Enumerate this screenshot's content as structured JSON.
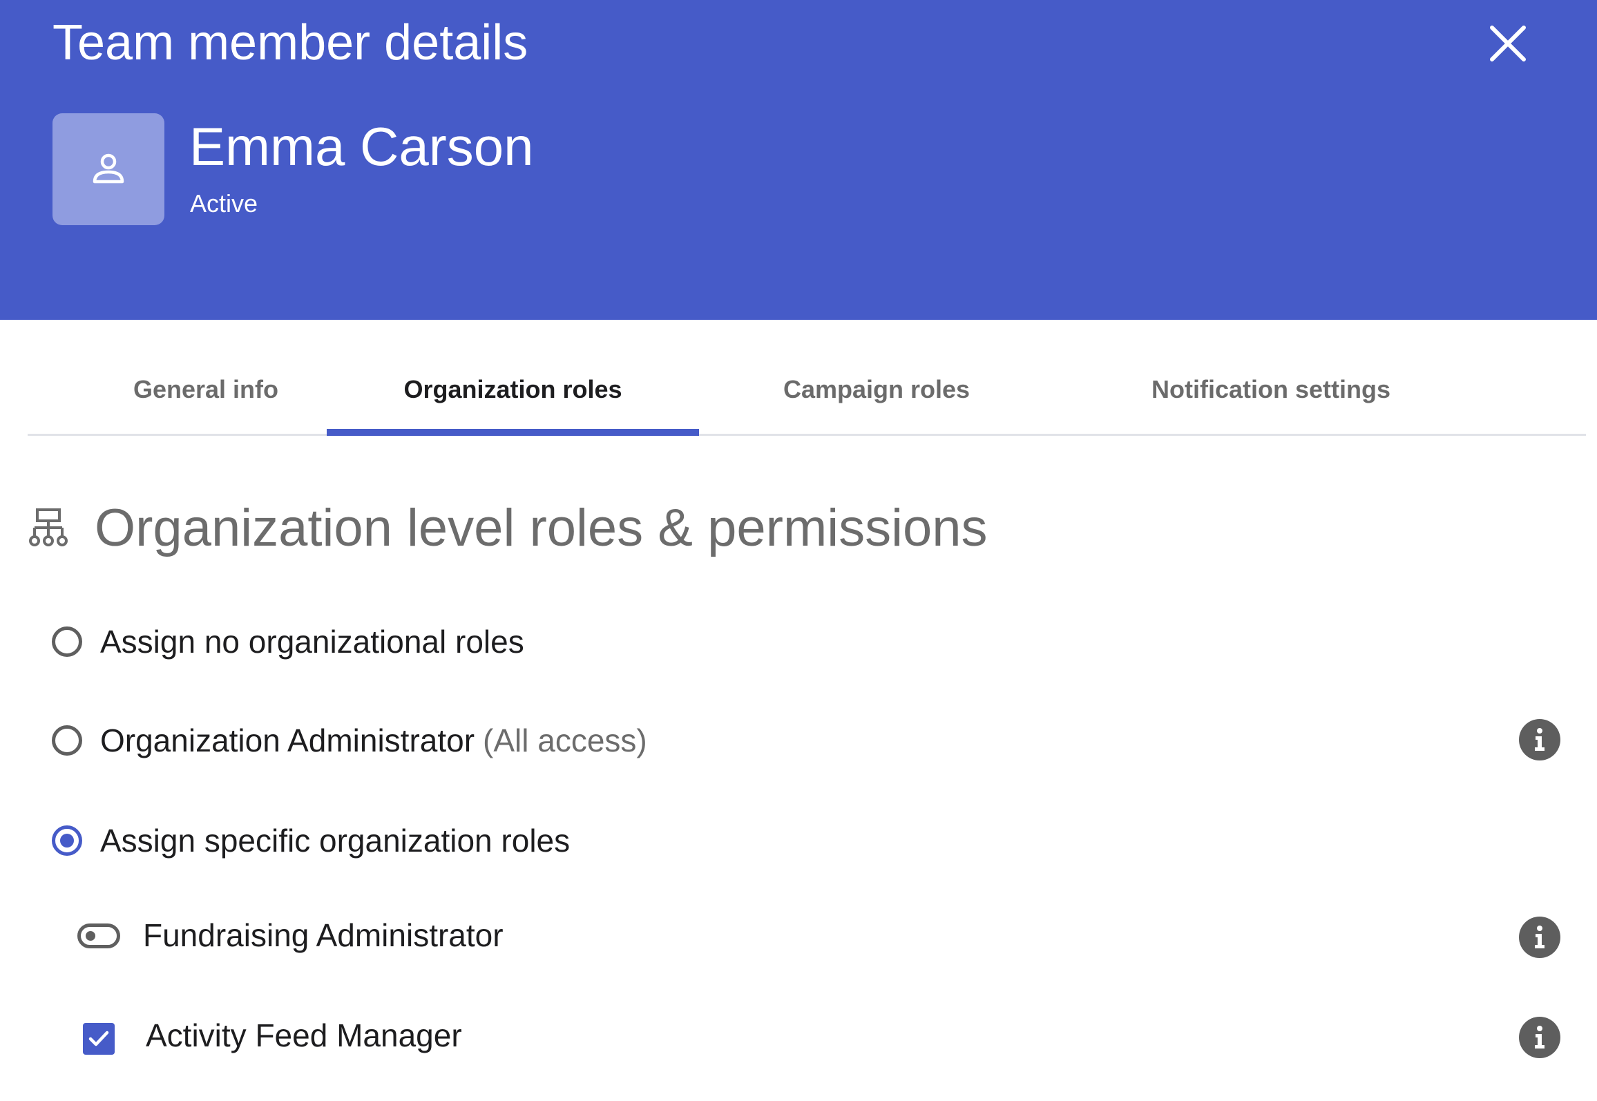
{
  "header": {
    "title": "Team member details",
    "close_icon": "close-icon",
    "avatar_icon": "user-icon",
    "member_name": "Emma Carson",
    "member_status": "Active",
    "background_color": "#465bc8"
  },
  "tabs": [
    {
      "label": "General info",
      "active": false
    },
    {
      "label": "Organization roles",
      "active": true
    },
    {
      "label": "Campaign roles",
      "active": false
    },
    {
      "label": "Notification settings",
      "active": false
    }
  ],
  "section": {
    "icon": "org-chart-icon",
    "title": "Organization level roles & permissions"
  },
  "role_options": [
    {
      "label": "Assign no organizational roles",
      "note": "",
      "selected": false
    },
    {
      "label": "Organization Administrator",
      "note": "(All access)",
      "selected": false
    },
    {
      "label": "Assign specific organization roles",
      "note": "",
      "selected": true
    }
  ],
  "specific_roles": [
    {
      "label": "Fundraising Administrator",
      "control": "toggle",
      "enabled": false
    },
    {
      "label": "Activity Feed Manager",
      "control": "checkbox",
      "enabled": true
    }
  ],
  "accent_color": "#465bc8"
}
